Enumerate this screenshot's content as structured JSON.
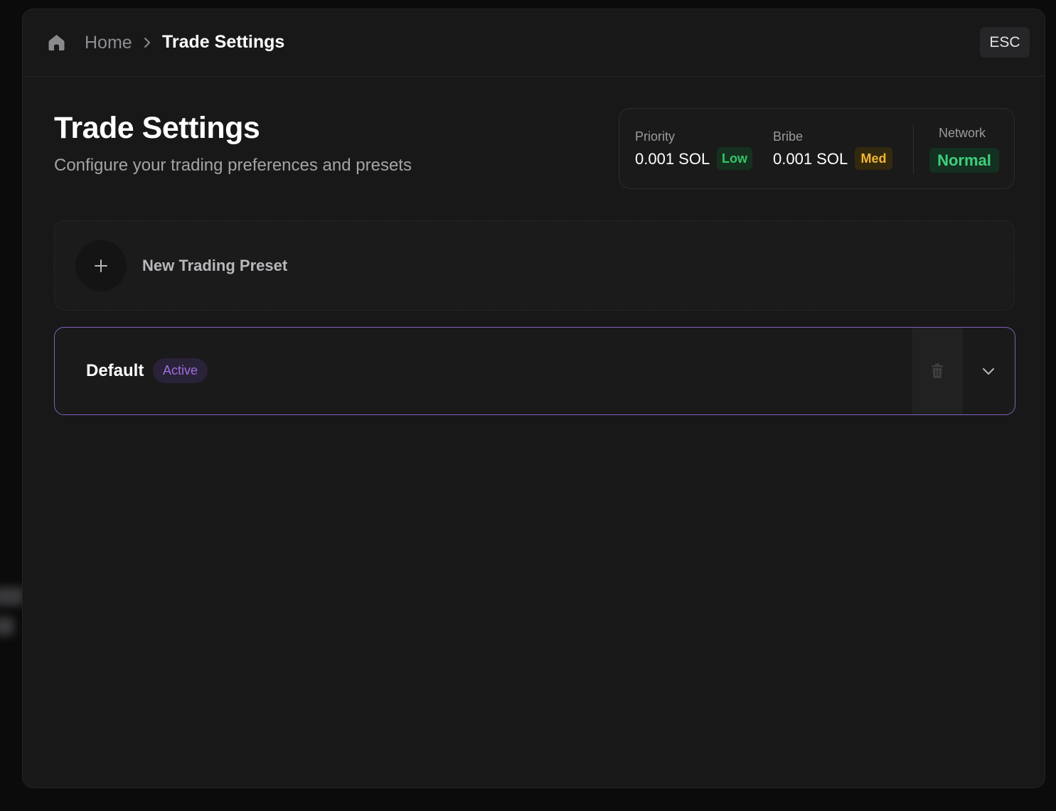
{
  "breadcrumb": {
    "home_icon": "home-icon",
    "home_label": "Home",
    "separator_icon": "chevron-right-icon",
    "current_label": "Trade Settings"
  },
  "esc_label": "ESC",
  "header": {
    "title": "Trade Settings",
    "subtitle": "Configure your trading preferences and presets"
  },
  "fees": {
    "priority": {
      "label": "Priority",
      "value": "0.001 SOL",
      "level": "Low",
      "level_color": "#34c46a"
    },
    "bribe": {
      "label": "Bribe",
      "value": "0.001 SOL",
      "level": "Med",
      "level_color": "#f2b534"
    },
    "network": {
      "label": "Network",
      "status": "Normal",
      "status_color": "#3fcf7c"
    }
  },
  "new_preset": {
    "icon": "plus-icon",
    "label": "New Trading Preset"
  },
  "presets": [
    {
      "name": "Default",
      "status": "Active",
      "accent_color": "#7e62b8",
      "delete_icon": "trash-icon",
      "expand_icon": "chevron-down-icon"
    }
  ]
}
